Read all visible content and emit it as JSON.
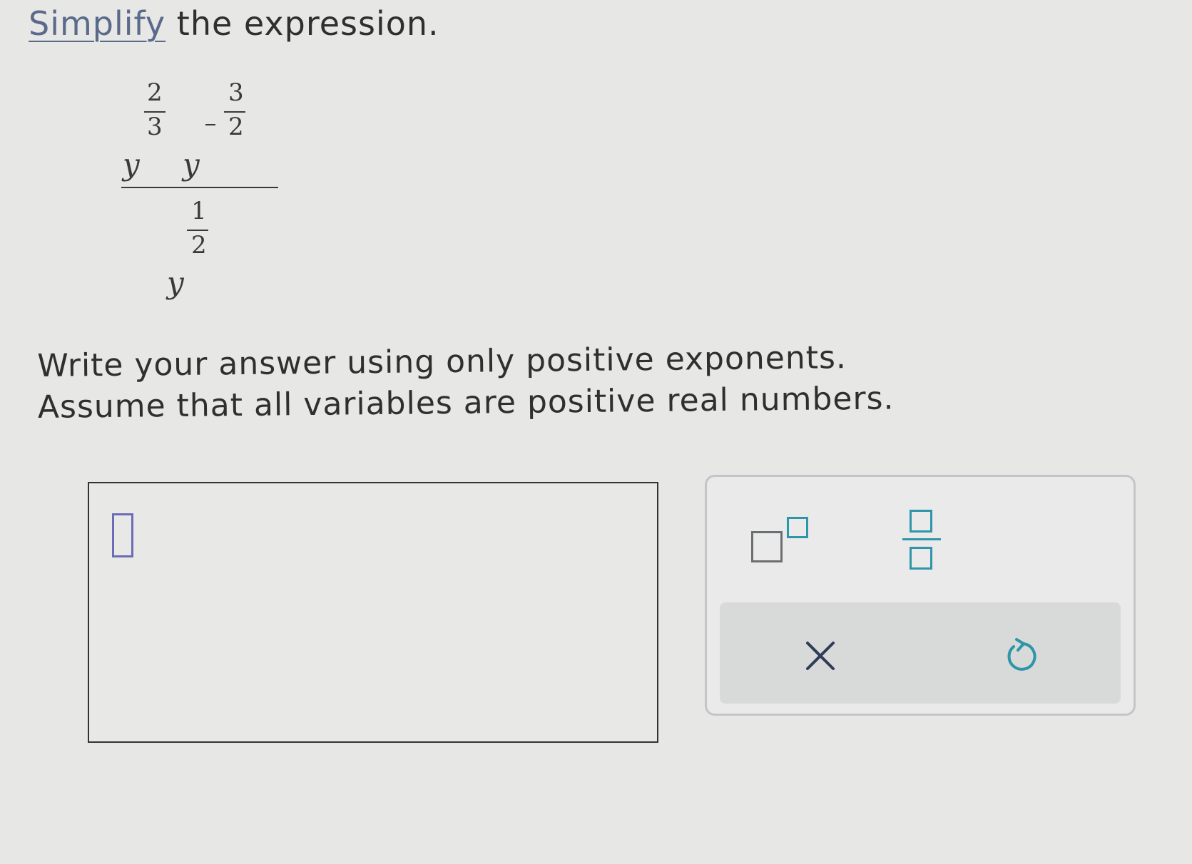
{
  "prompt": {
    "link_word": "Simplify",
    "rest": "the expression."
  },
  "expression": {
    "variable": "y",
    "numerator": [
      {
        "base": "y",
        "exponent_sign": "",
        "exponent_num": "2",
        "exponent_den": "3"
      },
      {
        "base": "y",
        "exponent_sign": "-",
        "exponent_num": "3",
        "exponent_den": "2"
      }
    ],
    "denominator": {
      "base": "y",
      "exponent_num": "1",
      "exponent_den": "2"
    }
  },
  "instructions": {
    "line1": "Write your answer using only positive exponents.",
    "line2": "Assume that all variables are positive real numbers."
  },
  "answer": {
    "value": ""
  },
  "toolbar": {
    "tools": [
      "superscript-icon",
      "fraction-icon"
    ],
    "actions": [
      {
        "icon": "clear-icon",
        "glyph": "×"
      },
      {
        "icon": "undo-icon",
        "glyph": "↺"
      }
    ],
    "accent_color": "#2e96a8"
  }
}
